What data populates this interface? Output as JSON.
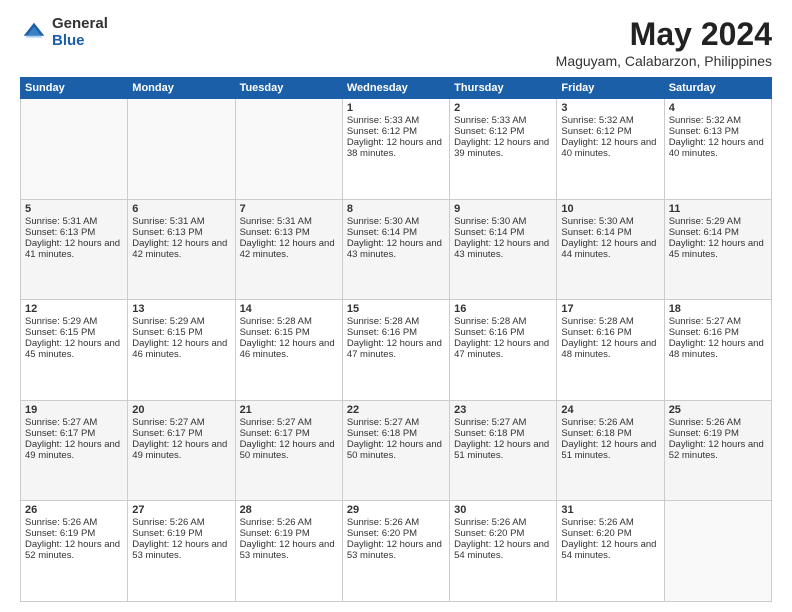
{
  "logo": {
    "general": "General",
    "blue": "Blue"
  },
  "header": {
    "title": "May 2024",
    "subtitle": "Maguyam, Calabarzon, Philippines"
  },
  "weekdays": [
    "Sunday",
    "Monday",
    "Tuesday",
    "Wednesday",
    "Thursday",
    "Friday",
    "Saturday"
  ],
  "weeks": [
    [
      {
        "day": "",
        "sunrise": "",
        "sunset": "",
        "daylight": ""
      },
      {
        "day": "",
        "sunrise": "",
        "sunset": "",
        "daylight": ""
      },
      {
        "day": "",
        "sunrise": "",
        "sunset": "",
        "daylight": ""
      },
      {
        "day": "1",
        "sunrise": "Sunrise: 5:33 AM",
        "sunset": "Sunset: 6:12 PM",
        "daylight": "Daylight: 12 hours and 38 minutes."
      },
      {
        "day": "2",
        "sunrise": "Sunrise: 5:33 AM",
        "sunset": "Sunset: 6:12 PM",
        "daylight": "Daylight: 12 hours and 39 minutes."
      },
      {
        "day": "3",
        "sunrise": "Sunrise: 5:32 AM",
        "sunset": "Sunset: 6:12 PM",
        "daylight": "Daylight: 12 hours and 40 minutes."
      },
      {
        "day": "4",
        "sunrise": "Sunrise: 5:32 AM",
        "sunset": "Sunset: 6:13 PM",
        "daylight": "Daylight: 12 hours and 40 minutes."
      }
    ],
    [
      {
        "day": "5",
        "sunrise": "Sunrise: 5:31 AM",
        "sunset": "Sunset: 6:13 PM",
        "daylight": "Daylight: 12 hours and 41 minutes."
      },
      {
        "day": "6",
        "sunrise": "Sunrise: 5:31 AM",
        "sunset": "Sunset: 6:13 PM",
        "daylight": "Daylight: 12 hours and 42 minutes."
      },
      {
        "day": "7",
        "sunrise": "Sunrise: 5:31 AM",
        "sunset": "Sunset: 6:13 PM",
        "daylight": "Daylight: 12 hours and 42 minutes."
      },
      {
        "day": "8",
        "sunrise": "Sunrise: 5:30 AM",
        "sunset": "Sunset: 6:14 PM",
        "daylight": "Daylight: 12 hours and 43 minutes."
      },
      {
        "day": "9",
        "sunrise": "Sunrise: 5:30 AM",
        "sunset": "Sunset: 6:14 PM",
        "daylight": "Daylight: 12 hours and 43 minutes."
      },
      {
        "day": "10",
        "sunrise": "Sunrise: 5:30 AM",
        "sunset": "Sunset: 6:14 PM",
        "daylight": "Daylight: 12 hours and 44 minutes."
      },
      {
        "day": "11",
        "sunrise": "Sunrise: 5:29 AM",
        "sunset": "Sunset: 6:14 PM",
        "daylight": "Daylight: 12 hours and 45 minutes."
      }
    ],
    [
      {
        "day": "12",
        "sunrise": "Sunrise: 5:29 AM",
        "sunset": "Sunset: 6:15 PM",
        "daylight": "Daylight: 12 hours and 45 minutes."
      },
      {
        "day": "13",
        "sunrise": "Sunrise: 5:29 AM",
        "sunset": "Sunset: 6:15 PM",
        "daylight": "Daylight: 12 hours and 46 minutes."
      },
      {
        "day": "14",
        "sunrise": "Sunrise: 5:28 AM",
        "sunset": "Sunset: 6:15 PM",
        "daylight": "Daylight: 12 hours and 46 minutes."
      },
      {
        "day": "15",
        "sunrise": "Sunrise: 5:28 AM",
        "sunset": "Sunset: 6:16 PM",
        "daylight": "Daylight: 12 hours and 47 minutes."
      },
      {
        "day": "16",
        "sunrise": "Sunrise: 5:28 AM",
        "sunset": "Sunset: 6:16 PM",
        "daylight": "Daylight: 12 hours and 47 minutes."
      },
      {
        "day": "17",
        "sunrise": "Sunrise: 5:28 AM",
        "sunset": "Sunset: 6:16 PM",
        "daylight": "Daylight: 12 hours and 48 minutes."
      },
      {
        "day": "18",
        "sunrise": "Sunrise: 5:27 AM",
        "sunset": "Sunset: 6:16 PM",
        "daylight": "Daylight: 12 hours and 48 minutes."
      }
    ],
    [
      {
        "day": "19",
        "sunrise": "Sunrise: 5:27 AM",
        "sunset": "Sunset: 6:17 PM",
        "daylight": "Daylight: 12 hours and 49 minutes."
      },
      {
        "day": "20",
        "sunrise": "Sunrise: 5:27 AM",
        "sunset": "Sunset: 6:17 PM",
        "daylight": "Daylight: 12 hours and 49 minutes."
      },
      {
        "day": "21",
        "sunrise": "Sunrise: 5:27 AM",
        "sunset": "Sunset: 6:17 PM",
        "daylight": "Daylight: 12 hours and 50 minutes."
      },
      {
        "day": "22",
        "sunrise": "Sunrise: 5:27 AM",
        "sunset": "Sunset: 6:18 PM",
        "daylight": "Daylight: 12 hours and 50 minutes."
      },
      {
        "day": "23",
        "sunrise": "Sunrise: 5:27 AM",
        "sunset": "Sunset: 6:18 PM",
        "daylight": "Daylight: 12 hours and 51 minutes."
      },
      {
        "day": "24",
        "sunrise": "Sunrise: 5:26 AM",
        "sunset": "Sunset: 6:18 PM",
        "daylight": "Daylight: 12 hours and 51 minutes."
      },
      {
        "day": "25",
        "sunrise": "Sunrise: 5:26 AM",
        "sunset": "Sunset: 6:19 PM",
        "daylight": "Daylight: 12 hours and 52 minutes."
      }
    ],
    [
      {
        "day": "26",
        "sunrise": "Sunrise: 5:26 AM",
        "sunset": "Sunset: 6:19 PM",
        "daylight": "Daylight: 12 hours and 52 minutes."
      },
      {
        "day": "27",
        "sunrise": "Sunrise: 5:26 AM",
        "sunset": "Sunset: 6:19 PM",
        "daylight": "Daylight: 12 hours and 53 minutes."
      },
      {
        "day": "28",
        "sunrise": "Sunrise: 5:26 AM",
        "sunset": "Sunset: 6:19 PM",
        "daylight": "Daylight: 12 hours and 53 minutes."
      },
      {
        "day": "29",
        "sunrise": "Sunrise: 5:26 AM",
        "sunset": "Sunset: 6:20 PM",
        "daylight": "Daylight: 12 hours and 53 minutes."
      },
      {
        "day": "30",
        "sunrise": "Sunrise: 5:26 AM",
        "sunset": "Sunset: 6:20 PM",
        "daylight": "Daylight: 12 hours and 54 minutes."
      },
      {
        "day": "31",
        "sunrise": "Sunrise: 5:26 AM",
        "sunset": "Sunset: 6:20 PM",
        "daylight": "Daylight: 12 hours and 54 minutes."
      },
      {
        "day": "",
        "sunrise": "",
        "sunset": "",
        "daylight": ""
      }
    ]
  ]
}
